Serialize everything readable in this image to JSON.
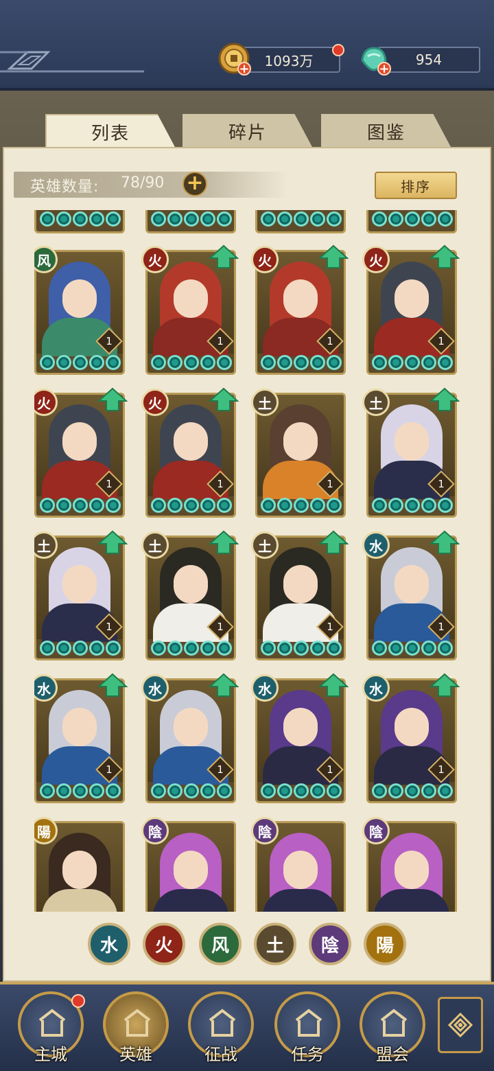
{
  "resources": {
    "coins": "1093万",
    "jade": "954"
  },
  "tabs": [
    "列表",
    "碎片",
    "图鉴"
  ],
  "hero_count": {
    "label": "英雄数量:",
    "value": "78/90"
  },
  "sort_label": "排序",
  "elements": {
    "fire": "火",
    "water": "水",
    "wind": "风",
    "earth": "土",
    "yin": "陰",
    "yang": "陽"
  },
  "element_colors": {
    "fire": "#8f2418",
    "water": "#1f5f6c",
    "wind": "#2c6a3c",
    "earth": "#5a4a2f",
    "yin": "#5d3a7a",
    "yang": "#a3720e"
  },
  "hero_rows": [
    [
      {
        "element": "wind",
        "level": "1",
        "upgrade": false,
        "stars": 5,
        "hair": "#3f5fa8",
        "outfit": "#3b8a6a"
      },
      {
        "element": "fire",
        "level": "1",
        "upgrade": true,
        "stars": 5,
        "hair": "#b33a2a",
        "outfit": "#8a2a22"
      },
      {
        "element": "fire",
        "level": "1",
        "upgrade": true,
        "stars": 5,
        "hair": "#b33a2a",
        "outfit": "#8a2a22"
      },
      {
        "element": "fire",
        "level": "1",
        "upgrade": true,
        "stars": 5,
        "hair": "#3f4550",
        "outfit": "#9a2a22"
      }
    ],
    [
      {
        "element": "fire",
        "level": "1",
        "upgrade": true,
        "stars": 5,
        "hair": "#3f4550",
        "outfit": "#9a2a22"
      },
      {
        "element": "fire",
        "level": "1",
        "upgrade": true,
        "stars": 5,
        "hair": "#3f4550",
        "outfit": "#9a2a22"
      },
      {
        "element": "earth",
        "level": "1",
        "upgrade": false,
        "stars": 5,
        "hair": "#5a4030",
        "outfit": "#d9822a"
      },
      {
        "element": "earth",
        "level": "1",
        "upgrade": true,
        "stars": 5,
        "hair": "#d8d4e6",
        "outfit": "#2b2e4a"
      }
    ],
    [
      {
        "element": "earth",
        "level": "1",
        "upgrade": true,
        "stars": 5,
        "hair": "#d8d4e6",
        "outfit": "#2b2e4a"
      },
      {
        "element": "earth",
        "level": "1",
        "upgrade": true,
        "stars": 5,
        "hair": "#2b2a22",
        "outfit": "#f0eee8"
      },
      {
        "element": "earth",
        "level": "1",
        "upgrade": true,
        "stars": 5,
        "hair": "#2b2a22",
        "outfit": "#f0eee8"
      },
      {
        "element": "water",
        "level": "1",
        "upgrade": true,
        "stars": 5,
        "hair": "#c9ccd6",
        "outfit": "#2a5a9a"
      }
    ],
    [
      {
        "element": "water",
        "level": "1",
        "upgrade": true,
        "stars": 5,
        "hair": "#c9ccd6",
        "outfit": "#2a5a9a"
      },
      {
        "element": "water",
        "level": "1",
        "upgrade": true,
        "stars": 5,
        "hair": "#c9ccd6",
        "outfit": "#2a5a9a"
      },
      {
        "element": "water",
        "level": "1",
        "upgrade": true,
        "stars": 5,
        "hair": "#5a3a8a",
        "outfit": "#2a2a44"
      },
      {
        "element": "water",
        "level": "1",
        "upgrade": true,
        "stars": 5,
        "hair": "#5a3a8a",
        "outfit": "#2a2a44"
      }
    ],
    [
      {
        "element": "yang",
        "level": "",
        "upgrade": false,
        "stars": 0,
        "hair": "#3a2a1f",
        "outfit": "#d8c9a2"
      },
      {
        "element": "yin",
        "level": "",
        "upgrade": false,
        "stars": 0,
        "hair": "#b860c4",
        "outfit": "#2a2a4a"
      },
      {
        "element": "yin",
        "level": "",
        "upgrade": false,
        "stars": 0,
        "hair": "#b860c4",
        "outfit": "#2a2a4a"
      },
      {
        "element": "yin",
        "level": "",
        "upgrade": false,
        "stars": 0,
        "hair": "#b860c4",
        "outfit": "#2a2a4a"
      }
    ]
  ],
  "filter_order": [
    "water",
    "fire",
    "wind",
    "earth",
    "yin",
    "yang"
  ],
  "nav": [
    {
      "label": "主城",
      "icon": "palace-icon",
      "notify": true
    },
    {
      "label": "英雄",
      "icon": "hero-portrait-icon",
      "notify": false
    },
    {
      "label": "征战",
      "icon": "drum-icon",
      "notify": false
    },
    {
      "label": "任务",
      "icon": "scroll-icon",
      "notify": false
    },
    {
      "label": "盟会",
      "icon": "pavilion-icon",
      "notify": false
    }
  ]
}
